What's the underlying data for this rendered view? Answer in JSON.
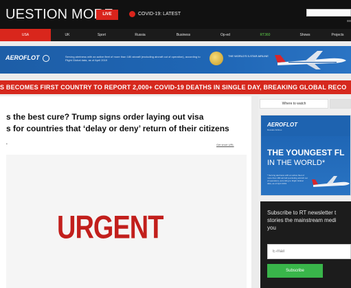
{
  "header": {
    "logo": "UESTION MORE",
    "live_label": "LIVE",
    "covid_label": "COVID-19: LATEST",
    "menu_hint": "≡≡"
  },
  "nav": {
    "items": [
      {
        "label": "USA",
        "active": true
      },
      {
        "label": "UK"
      },
      {
        "label": "Sport"
      },
      {
        "label": "Russia"
      },
      {
        "label": "Business"
      },
      {
        "label": "Op-ed"
      },
      {
        "label": "RT360",
        "highlight": "green"
      },
      {
        "label": "Shows"
      },
      {
        "label": "Projects"
      }
    ]
  },
  "ad_banner": {
    "brand": "AEROFLOT",
    "text": "Serving alertness with an active fleet of more than 180 aircraft (excluding aircraft out of operation), according to Flight Global data, as of April 2019",
    "medal_text": "THE WORLD'S 5-STAR AIRLINE"
  },
  "ticker": {
    "text": "S BECOMES FIRST COUNTRY TO REPORT 2,000+ COVID-19 DEATHS IN SINGLE DAY, BREAKING GLOBAL RECO"
  },
  "article": {
    "headline_line1": "s the best cure? Trump signs order laying out visa",
    "headline_line2": "s for countries that ‘delay or deny’ return of their citizens",
    "short_url": "Get short URL",
    "hero_text": "URGENT"
  },
  "sidebar": {
    "where_to_watch": "Where to watch",
    "ad": {
      "brand": "AEROFLOT",
      "sub": "Russian Airlines",
      "title1": "THE YOUNGEST FL",
      "title2": "IN THE WORLD*",
      "fine": "* Serving alertness with an active fleet of more than 180 aircraft (excluding aircraft out of operation), according to Flight Global data, as of April 2019"
    },
    "newsletter": {
      "line1": "Subscribe to RT newsletter t",
      "line2": "stories the mainstream medi",
      "line3": "you",
      "email_placeholder": "E-mail",
      "subscribe_label": "Subscribe"
    }
  },
  "colors": {
    "brand_red": "#d9241c",
    "dark_bg": "#111111",
    "aeroflot_blue": "#1f66b5",
    "subscribe_green": "#39b54a"
  }
}
